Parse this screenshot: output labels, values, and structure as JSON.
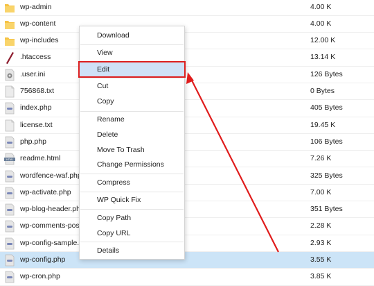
{
  "files": [
    {
      "name": "wp-admin",
      "size": "4.00 K",
      "icon": "folder-icon"
    },
    {
      "name": "wp-content",
      "size": "4.00 K",
      "icon": "folder-icon"
    },
    {
      "name": "wp-includes",
      "size": "12.00 K",
      "icon": "folder-icon"
    },
    {
      "name": ".htaccess",
      "size": "13.14 K",
      "icon": "htaccess-file-icon"
    },
    {
      "name": ".user.ini",
      "size": "126 Bytes",
      "icon": "settings-file-icon"
    },
    {
      "name": "756868.txt",
      "size": "0 Bytes",
      "icon": "text-file-icon"
    },
    {
      "name": "index.php",
      "size": "405 Bytes",
      "icon": "php-file-icon"
    },
    {
      "name": "license.txt",
      "size": "19.45 K",
      "icon": "text-file-icon"
    },
    {
      "name": "php.php",
      "size": "106 Bytes",
      "icon": "php-file-icon"
    },
    {
      "name": "readme.html",
      "size": "7.26 K",
      "icon": "html-file-icon"
    },
    {
      "name": "wordfence-waf.php",
      "size": "325 Bytes",
      "icon": "php-file-icon"
    },
    {
      "name": "wp-activate.php",
      "size": "7.00 K",
      "icon": "php-file-icon"
    },
    {
      "name": "wp-blog-header.php",
      "size": "351 Bytes",
      "icon": "php-file-icon"
    },
    {
      "name": "wp-comments-post.php",
      "size": "2.28 K",
      "icon": "php-file-icon"
    },
    {
      "name": "wp-config-sample.php",
      "size": "2.93 K",
      "icon": "php-file-icon"
    },
    {
      "name": "wp-config.php",
      "size": "3.55 K",
      "icon": "php-file-icon",
      "selected": true
    },
    {
      "name": "wp-cron.php",
      "size": "3.85 K",
      "icon": "php-file-icon"
    }
  ],
  "context_menu": {
    "groups": [
      [
        {
          "label": "Download"
        }
      ],
      [
        {
          "label": "View"
        },
        {
          "label": "Edit",
          "highlighted": true
        }
      ],
      [
        {
          "label": "Cut"
        },
        {
          "label": "Copy"
        }
      ],
      [
        {
          "label": "Rename"
        },
        {
          "label": "Delete"
        },
        {
          "label": "Move To Trash"
        },
        {
          "label": "Change Permissions"
        }
      ],
      [
        {
          "label": "Compress"
        }
      ],
      [
        {
          "label": "WP Quick Fix"
        }
      ],
      [
        {
          "label": "Copy Path"
        },
        {
          "label": "Copy URL"
        }
      ],
      [
        {
          "label": "Details"
        }
      ]
    ]
  },
  "colors": {
    "folder": "#f6c344",
    "selection": "#cce4f7",
    "highlight_border": "#dd1f1f",
    "arrow": "#e01c1c"
  }
}
